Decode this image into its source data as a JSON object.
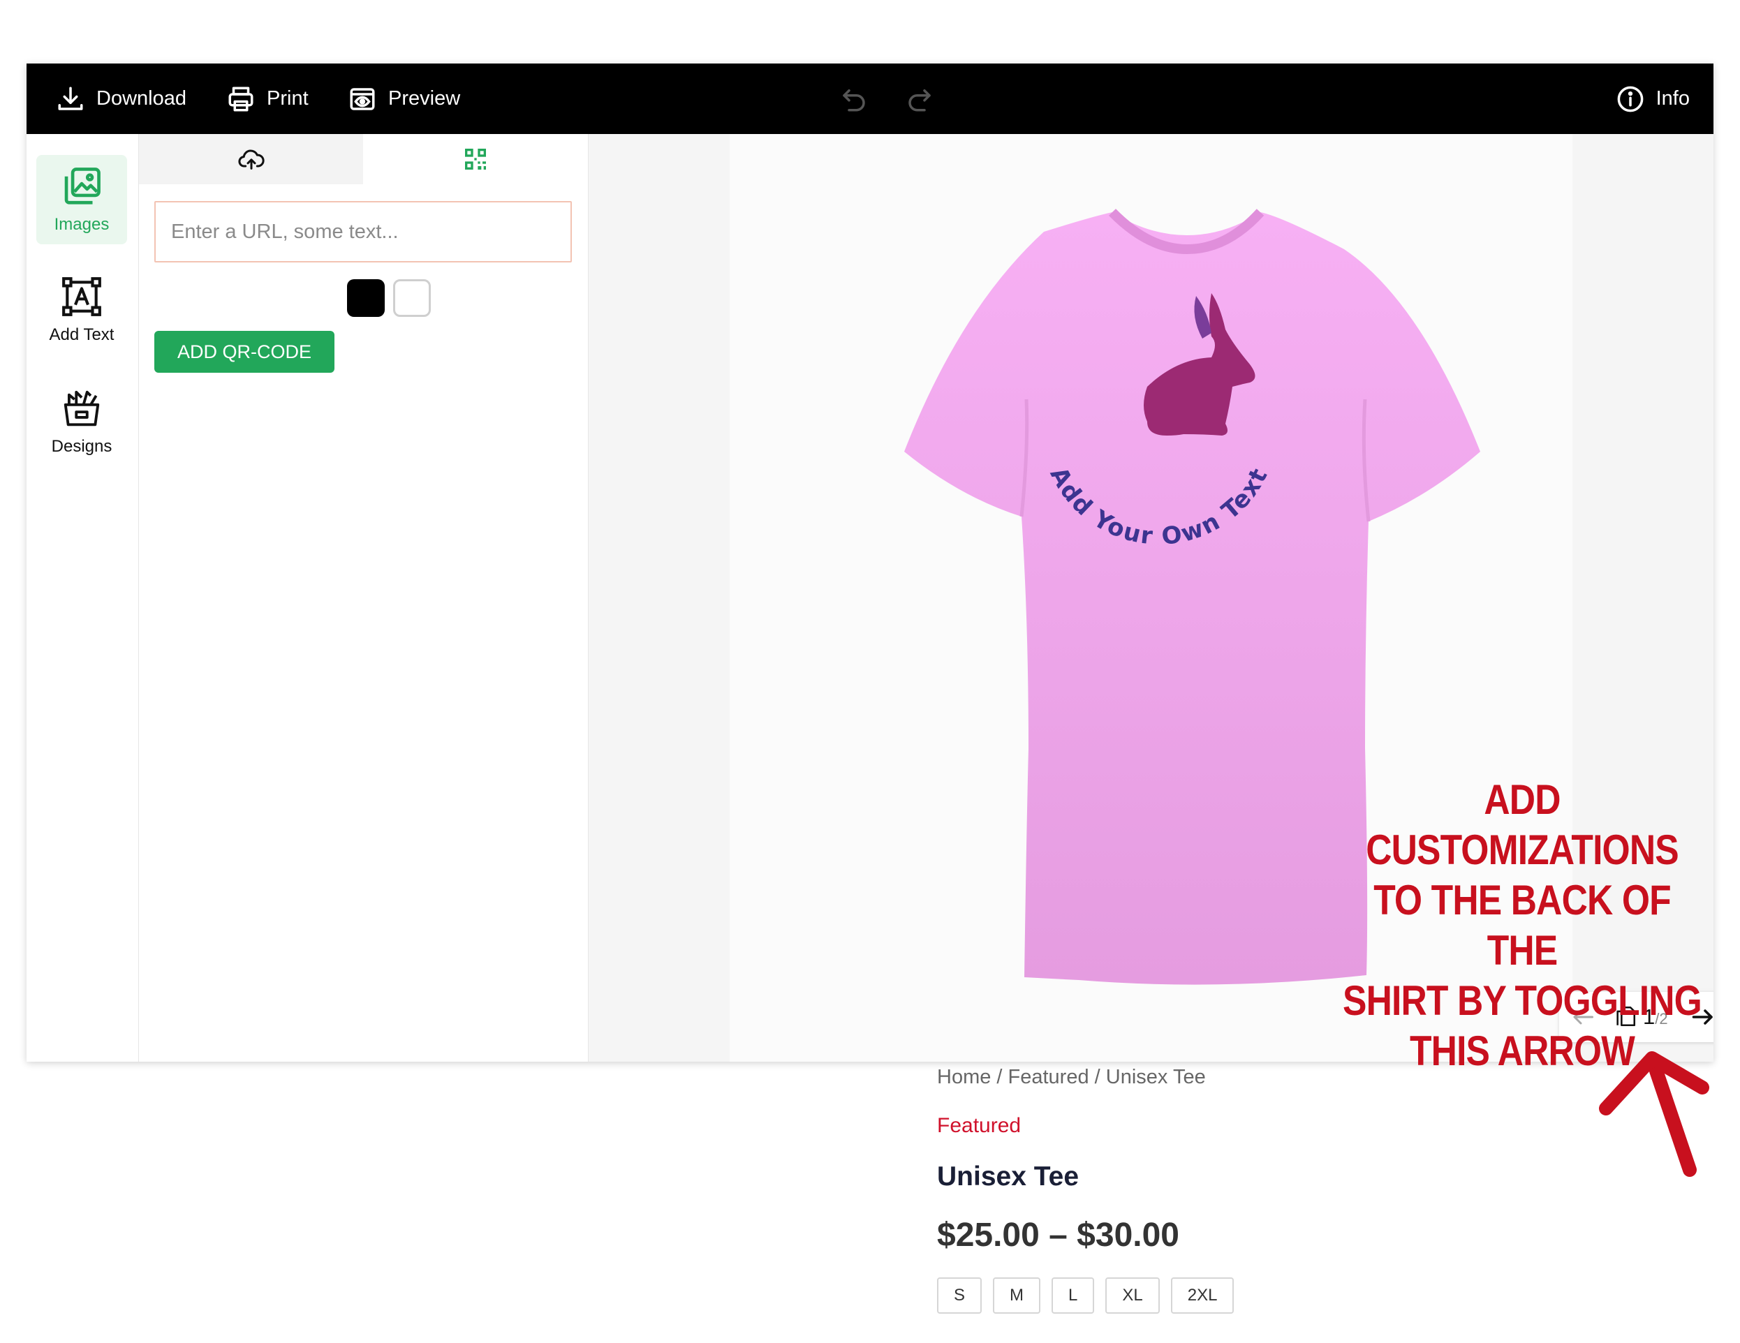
{
  "toolbar": {
    "download_label": "Download",
    "print_label": "Print",
    "preview_label": "Preview",
    "info_label": "Info"
  },
  "sidenav": {
    "items": [
      {
        "label": "Images",
        "icon": "images-icon",
        "active": true
      },
      {
        "label": "Add Text",
        "icon": "add-text-icon",
        "active": false
      },
      {
        "label": "Designs",
        "icon": "designs-icon",
        "active": false
      }
    ]
  },
  "panel": {
    "tabs": [
      {
        "icon": "cloud-upload-icon"
      },
      {
        "icon": "qr-code-icon",
        "active": true
      }
    ],
    "qr_input": {
      "placeholder": "Enter a URL, some text...",
      "value": ""
    },
    "colors": [
      "#000000",
      "#ffffff"
    ],
    "add_button_label": "ADD QR-CODE"
  },
  "canvas": {
    "design_text": "Add Your Own Text",
    "shirt_color": "#f3a8f0",
    "design_color": "#9c2a73",
    "text_color": "#3c3490"
  },
  "pager": {
    "current": "1",
    "total": "/2"
  },
  "annotation": {
    "lines": [
      "ADD CUSTOMIZATIONS",
      "TO THE BACK OF THE",
      "SHIRT BY TOGGLING",
      "THIS ARROW"
    ],
    "color": "#c8101e"
  },
  "product": {
    "breadcrumb": "Home / Featured / Unisex Tee",
    "category": "Featured",
    "title": "Unisex Tee",
    "price": "$25.00 – $30.00",
    "sizes": [
      "S",
      "M",
      "L",
      "XL",
      "2XL"
    ]
  },
  "colors": {
    "accent": "#22a75a",
    "category_red": "#d0112b",
    "toolbar_bg": "#000000"
  }
}
